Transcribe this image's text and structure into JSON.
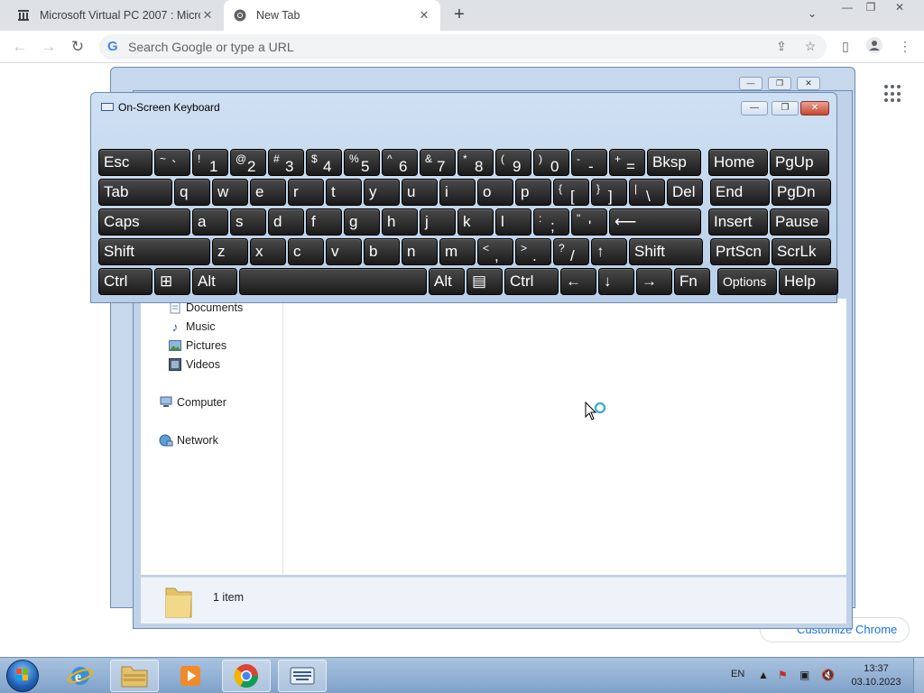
{
  "browser": {
    "tabs": [
      {
        "title": "Microsoft Virtual PC 2007 : Micro",
        "active": false
      },
      {
        "title": "New Tab",
        "active": true
      }
    ],
    "new_tab": "+",
    "omnibox_placeholder": "Search Google or type a URL",
    "customize_label": "Customize Chrome",
    "window_controls": {
      "minimize": "—",
      "restore": "❐",
      "close": "✕"
    }
  },
  "explorer": {
    "nav_items": [
      "Documents",
      "Music",
      "Pictures",
      "Videos",
      "Computer",
      "Network"
    ],
    "status": "1 item"
  },
  "osk": {
    "title": "On-Screen Keyboard",
    "rows": [
      [
        {
          "m": "Esc"
        },
        {
          "s": "~",
          "m": "`"
        },
        {
          "s": "!",
          "m": "1"
        },
        {
          "s": "@",
          "m": "2"
        },
        {
          "s": "#",
          "m": "3"
        },
        {
          "s": "$",
          "m": "4"
        },
        {
          "s": "%",
          "m": "5"
        },
        {
          "s": "^",
          "m": "6"
        },
        {
          "s": "&",
          "m": "7"
        },
        {
          "s": "*",
          "m": "8"
        },
        {
          "s": "(",
          "m": "9"
        },
        {
          "s": ")",
          "m": "0"
        },
        {
          "s": "-",
          "m": "-"
        },
        {
          "s": "+",
          "m": "="
        },
        {
          "m": "Bksp"
        },
        {
          "m": "Home"
        },
        {
          "m": "PgUp"
        }
      ],
      [
        {
          "m": "Tab"
        },
        {
          "m": "q"
        },
        {
          "m": "w"
        },
        {
          "m": "e"
        },
        {
          "m": "r"
        },
        {
          "m": "t"
        },
        {
          "m": "y"
        },
        {
          "m": "u"
        },
        {
          "m": "i"
        },
        {
          "m": "o"
        },
        {
          "m": "p"
        },
        {
          "s": "{",
          "m": "["
        },
        {
          "s": "}",
          "m": "]"
        },
        {
          "s": "|",
          "m": "\\"
        },
        {
          "m": "Del"
        },
        {
          "m": "End"
        },
        {
          "m": "PgDn"
        }
      ],
      [
        {
          "m": "Caps"
        },
        {
          "m": "a"
        },
        {
          "m": "s"
        },
        {
          "m": "d"
        },
        {
          "m": "f"
        },
        {
          "m": "g"
        },
        {
          "m": "h"
        },
        {
          "m": "j"
        },
        {
          "m": "k"
        },
        {
          "m": "l"
        },
        {
          "s": ":",
          "m": ";"
        },
        {
          "s": "\"",
          "m": "'"
        },
        {
          "m": "⟵"
        },
        {
          "m": "Insert"
        },
        {
          "m": "Pause"
        }
      ],
      [
        {
          "m": "Shift"
        },
        {
          "m": "z"
        },
        {
          "m": "x"
        },
        {
          "m": "c"
        },
        {
          "m": "v"
        },
        {
          "m": "b"
        },
        {
          "m": "n"
        },
        {
          "m": "m"
        },
        {
          "s": "<",
          "m": ","
        },
        {
          "s": ">",
          "m": "."
        },
        {
          "s": "?",
          "m": "/"
        },
        {
          "m": "↑"
        },
        {
          "m": "Shift"
        },
        {
          "m": "PrtScn"
        },
        {
          "m": "ScrLk"
        }
      ],
      [
        {
          "m": "Ctrl"
        },
        {
          "m": "⊞"
        },
        {
          "m": "Alt"
        },
        {
          "m": ""
        },
        {
          "m": "Alt"
        },
        {
          "m": "▤"
        },
        {
          "m": "Ctrl"
        },
        {
          "m": "←"
        },
        {
          "m": "↓"
        },
        {
          "m": "→"
        },
        {
          "m": "Fn"
        },
        {
          "m": "Options"
        },
        {
          "m": "Help"
        }
      ]
    ]
  },
  "taskbar": {
    "language": "EN",
    "time": "13:37",
    "date": "03.10.2023",
    "apps": [
      "start-orb",
      "ie-icon",
      "explorer-icon",
      "media-player-icon",
      "chrome-icon",
      "osk-icon"
    ]
  }
}
